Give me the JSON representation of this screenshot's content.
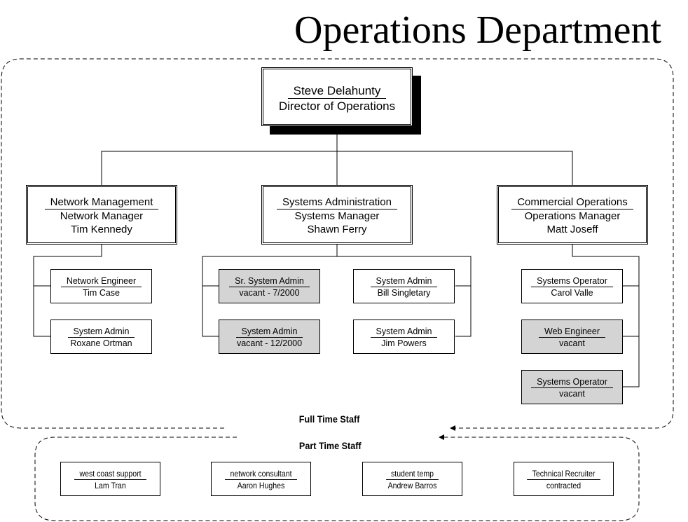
{
  "title": "Operations Department",
  "director": {
    "name": "Steve Delahunty",
    "title": "Director of Operations"
  },
  "managers": [
    {
      "dept": "Network Management",
      "role": "Network Manager",
      "name": "Tim Kennedy"
    },
    {
      "dept": "Systems Administration",
      "role": "Systems Manager",
      "name": "Shawn Ferry"
    },
    {
      "dept": "Commercial Operations",
      "role": "Operations Manager",
      "name": "Matt Joseff"
    }
  ],
  "staff": [
    {
      "role": "Network Engineer",
      "name": "Tim Case",
      "vacant": false
    },
    {
      "role": "System Admin",
      "name": "Roxane Ortman",
      "vacant": false
    },
    {
      "role": "Sr. System Admin",
      "name": "vacant - 7/2000",
      "vacant": true
    },
    {
      "role": "System Admin",
      "name": "vacant  - 12/2000",
      "vacant": true
    },
    {
      "role": "System Admin",
      "name": "Bill Singletary",
      "vacant": false
    },
    {
      "role": "System Admin",
      "name": "Jim Powers",
      "vacant": false
    },
    {
      "role": "Systems Operator",
      "name": "Carol Valle",
      "vacant": false
    },
    {
      "role": "Web Engineer",
      "name": "vacant",
      "vacant": true
    },
    {
      "role": "Systems Operator",
      "name": "vacant",
      "vacant": true
    }
  ],
  "full_time_label": "Full Time Staff",
  "part_time_label": "Part Time Staff",
  "part_time": [
    {
      "role": "west coast support",
      "name": "Lam Tran"
    },
    {
      "role": "network consultant",
      "name": "Aaron Hughes"
    },
    {
      "role": "student temp",
      "name": "Andrew Barros"
    },
    {
      "role": "Technical Recruiter",
      "name": "contracted"
    }
  ],
  "colors": {
    "vacant_fill": "#d4d4d4",
    "line": "#000000"
  }
}
